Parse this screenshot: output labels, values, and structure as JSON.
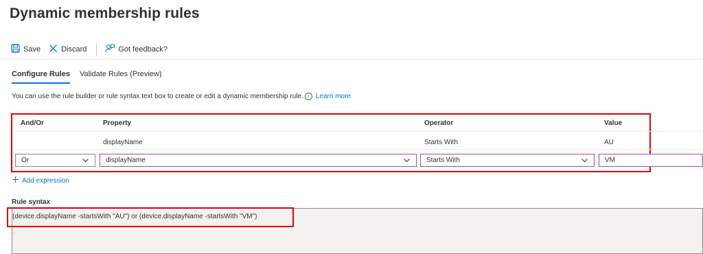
{
  "page": {
    "title": "Dynamic membership rules",
    "more": "···"
  },
  "toolbar": {
    "save_label": "Save",
    "discard_label": "Discard",
    "feedback_label": "Got feedback?"
  },
  "tabs": [
    {
      "label": "Configure Rules",
      "active": true
    },
    {
      "label": "Validate Rules (Preview)",
      "active": false
    }
  ],
  "description": {
    "text": "You can use the rule builder or rule syntax text box to create or edit a dynamic membership rule.",
    "link": "Learn more"
  },
  "rules_table": {
    "headers": [
      "And/Or",
      "Property",
      "Operator",
      "Value"
    ],
    "rows": [
      {
        "andor": "",
        "property": "displayName",
        "operator": "Starts With",
        "value": "AU"
      }
    ],
    "edit_row": {
      "andor": "Or",
      "property": "displayName",
      "operator": "Starts With",
      "value": "VM"
    }
  },
  "add_expression_label": "Add expression",
  "rule_syntax": {
    "label": "Rule syntax",
    "value": "(device.displayName -startsWith \"AU\") or (device.displayName -startsWith \"VM\")"
  },
  "colors": {
    "accent": "#0078d4",
    "highlight": "#e00000",
    "selected_border": "#a347b4"
  },
  "icons": [
    "save-icon",
    "discard-icon",
    "feedback-icon",
    "info-icon",
    "chevron-down-icon",
    "plus-icon"
  ]
}
